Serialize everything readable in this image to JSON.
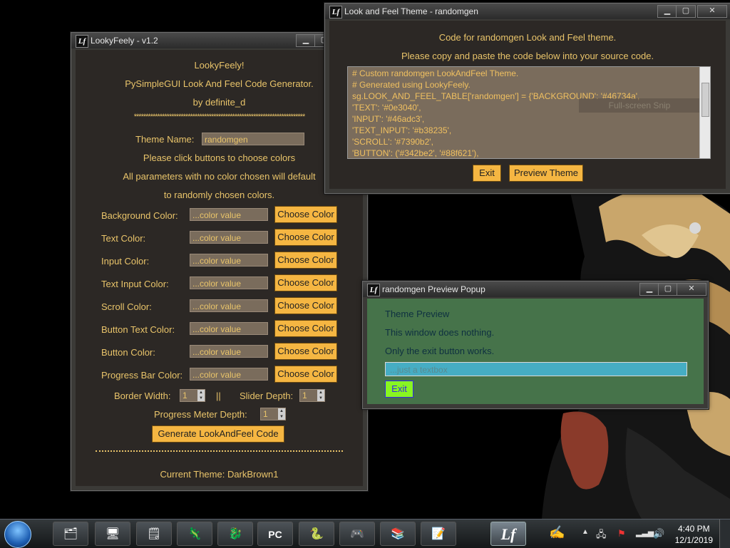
{
  "lookyfeely": {
    "title": "LookyFeely - v1.2",
    "heading": "LookyFeely!",
    "subtitle": "PySimpleGUI Look And Feel Code Generator.",
    "author": "by definite_d",
    "stars": "*************************************************************************",
    "theme_name_label": "Theme Name:",
    "theme_name_value": "randomgen",
    "instruction_1": "Please click buttons to choose colors",
    "instruction_2": "All parameters with no color chosen will default",
    "instruction_3": "to randomly chosen colors.",
    "color_rows": [
      {
        "label": "Background Color:",
        "value": "...color value",
        "button": "Choose Color"
      },
      {
        "label": "Text Color:",
        "value": "...color value",
        "button": "Choose Color"
      },
      {
        "label": "Input Color:",
        "value": "...color value",
        "button": "Choose Color"
      },
      {
        "label": "Text Input Color:",
        "value": "...color value",
        "button": "Choose Color"
      },
      {
        "label": "Scroll Color:",
        "value": "...color value",
        "button": "Choose Color"
      },
      {
        "label": "Button Text Color:",
        "value": "...color value",
        "button": "Choose Color"
      },
      {
        "label": "Button Color:",
        "value": "...color value",
        "button": "Choose Color"
      },
      {
        "label": "Progress Bar Color:",
        "value": "...color value",
        "button": "Choose Color"
      }
    ],
    "border_width_label": "Border Width:",
    "border_width_value": "1",
    "separator": "||",
    "slider_depth_label": "Slider Depth:",
    "slider_depth_value": "1",
    "progress_depth_label": "Progress Meter Depth:",
    "progress_depth_value": "1",
    "generate_button": "Generate LookAndFeel Code",
    "current_theme": "Current Theme: DarkBrown1"
  },
  "code_window": {
    "title": "Look and Feel Theme - randomgen",
    "heading": "Code for randomgen Look and Feel theme.",
    "instruction": "Please copy and paste the code below into your source code.",
    "code_lines": [
      "# Custom randomgen LookAndFeel Theme.",
      "# Generated using LookyFeely.",
      "sg.LOOK_AND_FEEL_TABLE['randomgen'] = {'BACKGROUND': '#46734a',",
      "'TEXT': '#0e3040',",
      "'INPUT': '#46adc3',",
      "'TEXT_INPUT': '#b38235',",
      "'SCROLL': '#7390b2',",
      "'BUTTON': ('#342be2', '#88f621'),"
    ],
    "snip_hint": "Full-screen Snip",
    "exit_button": "Exit",
    "preview_button": "Preview Theme"
  },
  "preview_popup": {
    "title": "randomgen Preview Popup",
    "line_1": "Theme Preview",
    "line_2": "This window does nothing.",
    "line_3": "Only the exit button works.",
    "input_value": "...just a textbox",
    "exit_button": "Exit",
    "colors": {
      "background": "#46734a",
      "text": "#0e3040",
      "input": "#46adc3",
      "button_text": "#342be2",
      "button": "#88f621"
    }
  },
  "window_controls": {
    "minimize": "▁",
    "maximize": "▢",
    "close": "✕"
  },
  "taskbar": {
    "apps": [
      {
        "icon": "file-explorer-icon",
        "glyph": "🗂"
      },
      {
        "icon": "system-monitor-icon",
        "glyph": "🖥"
      },
      {
        "icon": "sticky-notes-icon",
        "glyph": "🗒"
      },
      {
        "icon": "chameleon-icon",
        "glyph": "🦎"
      },
      {
        "icon": "dragon-icon",
        "glyph": "🐉"
      },
      {
        "icon": "pycharm-icon",
        "glyph": "PC"
      },
      {
        "icon": "python-icon",
        "glyph": "🐍"
      },
      {
        "icon": "xbox-icon",
        "glyph": "🎮"
      },
      {
        "icon": "winrar-icon",
        "glyph": "📚"
      },
      {
        "icon": "notepad-icon",
        "glyph": "📝"
      },
      {
        "icon": "lookyfeely-icon",
        "glyph": "Lf"
      }
    ],
    "time": "4:40 PM",
    "date": "12/1/2019"
  }
}
